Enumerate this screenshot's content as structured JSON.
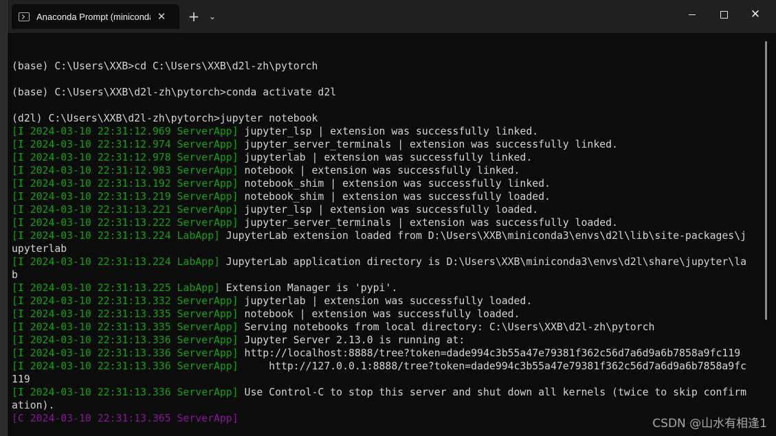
{
  "window": {
    "tab_title": "Anaconda Prompt (miniconda",
    "tab_close": "✕",
    "new_tab": "+",
    "tab_dropdown": "⌄",
    "controls": {
      "minimize": "",
      "maximize": "",
      "close": "✕"
    }
  },
  "icons": {
    "tab_icon": "terminal-icon",
    "close": "close-icon",
    "add": "plus-icon",
    "dropdown": "chevron-down-icon",
    "minimize": "minimize-icon",
    "maximize": "maximize-icon",
    "window_close": "close-icon"
  },
  "colors": {
    "terminal_bg": "#0c0c0c",
    "text": "#d4d4d4",
    "log_prefix_info": "#13a10e",
    "log_prefix_critical": "#881798"
  },
  "console": {
    "lines": [
      {
        "prefix": "",
        "text": "",
        "color": ""
      },
      {
        "prefix": "",
        "text": "(base) C:\\Users\\XXB>cd C:\\Users\\XXB\\d2l-zh\\pytorch",
        "color": ""
      },
      {
        "prefix": "",
        "text": "",
        "color": ""
      },
      {
        "prefix": "",
        "text": "(base) C:\\Users\\XXB\\d2l-zh\\pytorch>conda activate d2l",
        "color": ""
      },
      {
        "prefix": "",
        "text": "",
        "color": ""
      },
      {
        "prefix": "",
        "text": "(d2l) C:\\Users\\XXB\\d2l-zh\\pytorch>jupyter notebook",
        "color": ""
      },
      {
        "prefix": "[I 2024-03-10 22:31:12.969 ServerApp]",
        "text": " jupyter_lsp | extension was successfully linked.",
        "color": "green"
      },
      {
        "prefix": "[I 2024-03-10 22:31:12.974 ServerApp]",
        "text": " jupyter_server_terminals | extension was successfully linked.",
        "color": "green"
      },
      {
        "prefix": "[I 2024-03-10 22:31:12.978 ServerApp]",
        "text": " jupyterlab | extension was successfully linked.",
        "color": "green"
      },
      {
        "prefix": "[I 2024-03-10 22:31:12.983 ServerApp]",
        "text": " notebook | extension was successfully linked.",
        "color": "green"
      },
      {
        "prefix": "[I 2024-03-10 22:31:13.192 ServerApp]",
        "text": " notebook_shim | extension was successfully linked.",
        "color": "green"
      },
      {
        "prefix": "[I 2024-03-10 22:31:13.219 ServerApp]",
        "text": " notebook_shim | extension was successfully loaded.",
        "color": "green"
      },
      {
        "prefix": "[I 2024-03-10 22:31:13.221 ServerApp]",
        "text": " jupyter_lsp | extension was successfully loaded.",
        "color": "green"
      },
      {
        "prefix": "[I 2024-03-10 22:31:13.222 ServerApp]",
        "text": " jupyter_server_terminals | extension was successfully loaded.",
        "color": "green"
      },
      {
        "prefix": "[I 2024-03-10 22:31:13.224 LabApp]",
        "text": " JupyterLab extension loaded from D:\\Users\\XXB\\miniconda3\\envs\\d2l\\lib\\site-packages\\j",
        "color": "green"
      },
      {
        "prefix": "",
        "text": "upyterlab",
        "color": ""
      },
      {
        "prefix": "[I 2024-03-10 22:31:13.224 LabApp]",
        "text": " JupyterLab application directory is D:\\Users\\XXB\\miniconda3\\envs\\d2l\\share\\jupyter\\la",
        "color": "green"
      },
      {
        "prefix": "",
        "text": "b",
        "color": ""
      },
      {
        "prefix": "[I 2024-03-10 22:31:13.225 LabApp]",
        "text": " Extension Manager is 'pypi'.",
        "color": "green"
      },
      {
        "prefix": "[I 2024-03-10 22:31:13.332 ServerApp]",
        "text": " jupyterlab | extension was successfully loaded.",
        "color": "green"
      },
      {
        "prefix": "[I 2024-03-10 22:31:13.335 ServerApp]",
        "text": " notebook | extension was successfully loaded.",
        "color": "green"
      },
      {
        "prefix": "[I 2024-03-10 22:31:13.335 ServerApp]",
        "text": " Serving notebooks from local directory: C:\\Users\\XXB\\d2l-zh\\pytorch",
        "color": "green"
      },
      {
        "prefix": "[I 2024-03-10 22:31:13.336 ServerApp]",
        "text": " Jupyter Server 2.13.0 is running at:",
        "color": "green"
      },
      {
        "prefix": "[I 2024-03-10 22:31:13.336 ServerApp]",
        "text": " http://localhost:8888/tree?token=dade994c3b55a47e79381f362c56d7a6d9a6b7858a9fc119",
        "color": "green"
      },
      {
        "prefix": "[I 2024-03-10 22:31:13.336 ServerApp]",
        "text": "     http://127.0.0.1:8888/tree?token=dade994c3b55a47e79381f362c56d7a6d9a6b7858a9fc",
        "color": "green"
      },
      {
        "prefix": "",
        "text": "119",
        "color": ""
      },
      {
        "prefix": "[I 2024-03-10 22:31:13.336 ServerApp]",
        "text": " Use Control-C to stop this server and shut down all kernels (twice to skip confirm",
        "color": "green"
      },
      {
        "prefix": "",
        "text": "ation).",
        "color": ""
      },
      {
        "prefix": "[C 2024-03-10 22:31:13.365 ServerApp]",
        "text": "",
        "color": "purple"
      }
    ]
  },
  "watermark": "CSDN @山水有相逢1"
}
